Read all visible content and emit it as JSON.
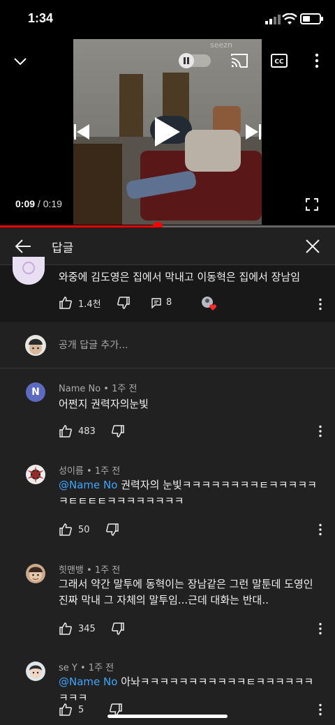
{
  "status_bar": {
    "time": "1:34"
  },
  "player": {
    "watermark": "seezn",
    "current_time": "0:09",
    "separator": "/",
    "duration": "0:19",
    "progress_fraction": 0.47
  },
  "replies_panel": {
    "title": "답글",
    "parent_comment": {
      "text": "와중에 김도영은 집에서 막내고 이동혁은 집에서 장남임",
      "likes": "1.4천",
      "reply_count": "8"
    },
    "add_reply_placeholder": "공개 답글 추가...",
    "replies": [
      {
        "avatar_letter": "N",
        "author": "Name No",
        "time": "1주 전",
        "mention": "",
        "text": "어쩐지 권력자의눈빛",
        "likes": "483"
      },
      {
        "author": "성이름",
        "time": "1주 전",
        "mention": "@Name No",
        "text": " 권력자의 눈빛ㅋㅋㅋㅋㅋㅋㅋㅋㅌㅋㅋㅋㅋㅋㅋㅌㅌㅌㅌㅋㅋㅋㅋㅋㅋㅋㅋ",
        "likes": "50"
      },
      {
        "author": "힛맨뱅",
        "time": "1주 전",
        "mention": "",
        "text": "그래서 약간 말투에 동혁이는 장남같은 그런 말툰데 도영인 진짜 막내 그 자체의 말투임...근데 대화는 반대..",
        "likes": "345"
      },
      {
        "author": "se Y",
        "time": "1주 전",
        "mention": "@Name No",
        "text": " 아놔ㅋㅋㅋㅋㅋㅋㅋㅋㅋㅋㅋㅌㅋㅋㅋㅋㅋㅋㅋㅋㅋ",
        "likes": "5"
      }
    ]
  },
  "colors": {
    "accent": "#ff0000",
    "mention": "#3ea6ff",
    "background": "#212121"
  }
}
